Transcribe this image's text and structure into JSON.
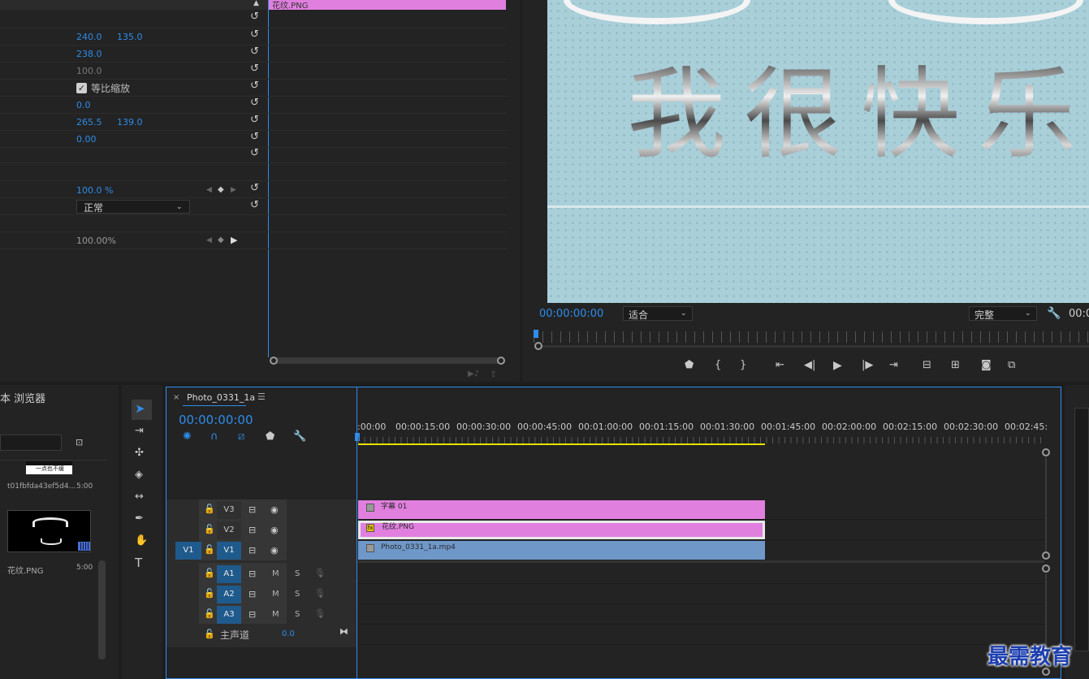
{
  "effect_controls": {
    "clip_bar_label": "花纹.PNG",
    "position_x": "240.0",
    "position_y": "135.0",
    "scale": "238.0",
    "scale_width": "100.0",
    "uniform_scale_label": "等比缩放",
    "rotation": "0.0",
    "anchor_x": "265.5",
    "anchor_y": "139.0",
    "antiflicker": "0.00",
    "opacity": "100.0 %",
    "blend_mode": "正常",
    "time_remap_speed": "100.00%"
  },
  "program_monitor": {
    "overlay_text": "我很快乐",
    "timecode": "00:00:00:00",
    "fit_option": "适合",
    "quality_option": "完整",
    "timecode_right": "00:0"
  },
  "project_panel": {
    "title": "本 浏览器",
    "item1_thumb_text": "一点也不缓",
    "item1_name": "t01fbfda43ef5d4...",
    "item1_duration": "5:00",
    "item2_name": "花纹.PNG",
    "item2_duration": "5:00"
  },
  "timeline": {
    "close_glyph": "×",
    "sequence_name": "Photo_0331_1a",
    "menu_glyph": "☰",
    "timecode": "00:00:00:00",
    "ruler_labels": [
      ":00:00",
      "00:00:15:00",
      "00:00:30:00",
      "00:00:45:00",
      "00:01:00:00",
      "00:01:15:00",
      "00:01:30:00",
      "00:01:45:00",
      "00:02:00:00",
      "00:02:15:00",
      "00:02:30:00",
      "00:02:45:"
    ],
    "tracks": {
      "v3": "V3",
      "v2": "V2",
      "v1": "V1",
      "v1_source": "V1",
      "a1": "A1",
      "a2": "A2",
      "a3": "A3",
      "m": "M",
      "s": "S",
      "master_label": "主声道",
      "master_value": "0.0"
    },
    "clips": {
      "title_clip": "字幕 01",
      "png_clip": "花纹.PNG",
      "video_clip": "Photo_0331_1a.mp4",
      "fx_badge": "fx"
    }
  },
  "watermark": "最需教育",
  "colors": {
    "accent_blue": "#2d8ceb",
    "clip_pink": "#e17fdf",
    "clip_blue": "#6f98c9",
    "monitor_bg": "#a9cfd9"
  }
}
